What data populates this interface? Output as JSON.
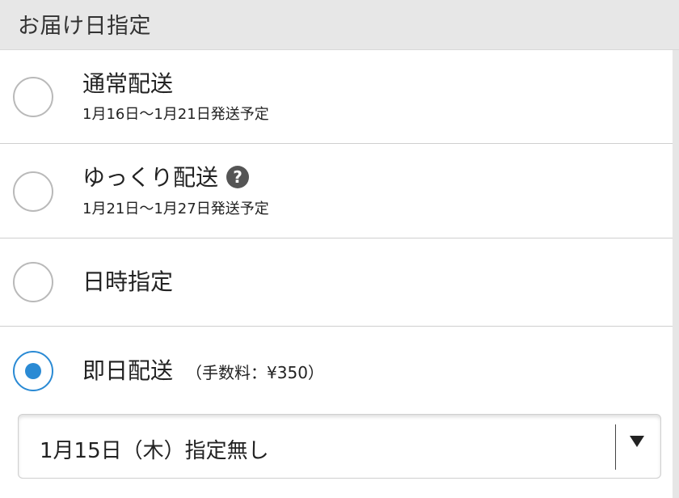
{
  "section": {
    "title": "お届け日指定"
  },
  "options": [
    {
      "label": "通常配送",
      "sub": "1月16日〜1月21日発送予定",
      "selected": false
    },
    {
      "label": "ゆっくり配送",
      "sub": "1月21日〜1月27日発送予定",
      "help_icon": "question-circle-icon",
      "help_glyph": "?",
      "selected": false
    },
    {
      "label": "日時指定",
      "selected": false
    },
    {
      "label": "即日配送",
      "fee": "（手数料：¥350）",
      "selected": true
    }
  ],
  "date_select": {
    "value": "1月15日（木）指定無し"
  },
  "colors": {
    "accent": "#2a8ad4",
    "header_bg": "#e7e7e7",
    "divider": "#cfcfcf"
  }
}
